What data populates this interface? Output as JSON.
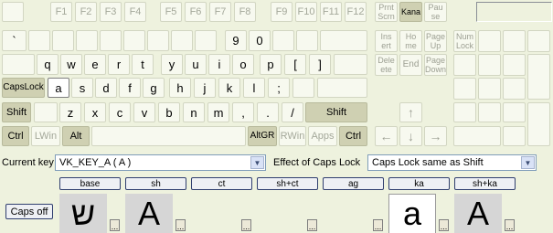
{
  "function_row": {
    "esc": "",
    "f1": "F1",
    "f2": "F2",
    "f3": "F3",
    "f4": "F4",
    "f5": "F5",
    "f6": "F6",
    "f7": "F7",
    "f8": "F8",
    "f9": "F9",
    "f10": "F10",
    "f11": "F11",
    "f12": "F12",
    "prtscn": "Prnt Scrn",
    "kana": "Kana",
    "pause": "Pau se"
  },
  "number_row": {
    "backtick": "`",
    "k9": "9",
    "k0": "0"
  },
  "qwerty_row": {
    "q": "q",
    "w": "w",
    "e": "e",
    "r": "r",
    "t": "t",
    "y": "y",
    "u": "u",
    "i": "i",
    "o": "o",
    "p": "p",
    "lbracket": "[",
    "rbracket": "]"
  },
  "home_row": {
    "capslock": "CapsLock",
    "a": "a",
    "s": "s",
    "d": "d",
    "f": "f",
    "g": "g",
    "h": "h",
    "j": "j",
    "k": "k",
    "l": "l",
    "semicolon": ";"
  },
  "bottom_row": {
    "shift_left": "Shift",
    "z": "z",
    "x": "x",
    "c": "c",
    "v": "v",
    "b": "b",
    "n": "n",
    "m": "m",
    "comma": ",",
    "period": ".",
    "slash": "/",
    "shift_right": "Shift"
  },
  "space_row": {
    "ctrl_left": "Ctrl",
    "lwin": "LWin",
    "alt": "Alt",
    "altgr": "AltGR",
    "rwin": "RWin",
    "apps": "Apps",
    "ctrl_right": "Ctrl"
  },
  "nav_keys": {
    "insert": "Ins ert",
    "home": "Ho me",
    "pageup": "Page Up",
    "delete": "Dele ete",
    "end": "End",
    "pagedown": "Page Down"
  },
  "numpad": {
    "numlock": "Num Lock"
  },
  "arrows": {
    "up": "↑",
    "left": "←",
    "down": "↓",
    "right": "→"
  },
  "controls": {
    "current_key_label": "Current key",
    "current_key_value": "VK_KEY_A ( A )",
    "caps_effect_label": "Effect of Caps Lock",
    "caps_effect_value": "Caps Lock same as Shift"
  },
  "shift_states": [
    "base",
    "sh",
    "ct",
    "sh+ct",
    "ag",
    "ka",
    "sh+ka"
  ],
  "caps_button": "Caps off",
  "glyphs": {
    "base": "ש",
    "sh": "A",
    "ka": "a",
    "shka": "A"
  },
  "ellipsis": "..."
}
